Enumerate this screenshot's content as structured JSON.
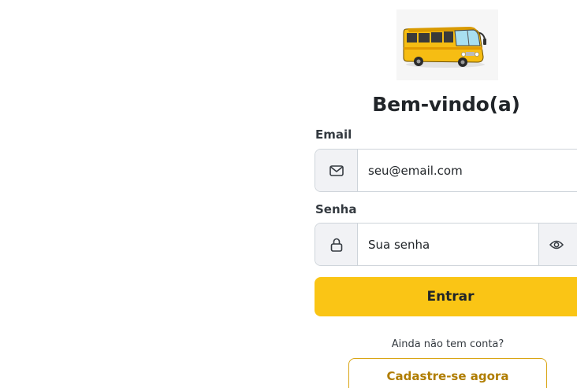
{
  "header": {
    "logo_name": "bus-logo",
    "title": "Bem-vindo(a)"
  },
  "form": {
    "email": {
      "label": "Email",
      "placeholder": "seu@email.com",
      "icon": "envelope-icon"
    },
    "senha": {
      "label": "Senha",
      "placeholder": "Sua senha",
      "icon": "lock-icon",
      "toggle_icon": "eye-icon"
    },
    "submit_label": "Entrar"
  },
  "signup": {
    "prompt": "Ainda não tem conta?",
    "button_label": "Cadastre-se agora"
  },
  "colors": {
    "accent": "#fac515",
    "accent_border": "#d9a514",
    "accent_text": "#b07d00",
    "addon_bg": "#f1f2f5"
  }
}
